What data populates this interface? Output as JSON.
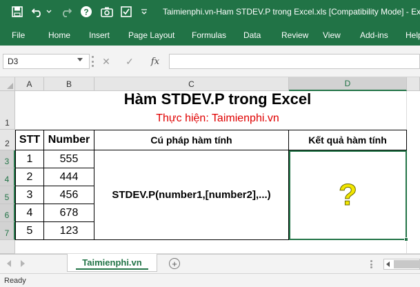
{
  "window": {
    "title": "Taimienphi.vn-Ham STDEV.P trong Excel.xls  [Compatibility Mode]  -  Excel"
  },
  "quick_access": {
    "save_icon": "save-icon",
    "undo_icon": "undo-icon",
    "redo_icon": "redo-icon",
    "help_icon": "help-icon",
    "camera_icon": "camera-icon",
    "checkbox_icon": "checkbox-icon",
    "customize_icon": "chevron-down-icon"
  },
  "ribbon": {
    "tabs": [
      "File",
      "Home",
      "Insert",
      "Page Layout",
      "Formulas",
      "Data",
      "Review",
      "View",
      "Add-ins",
      "Help"
    ]
  },
  "formula_bar": {
    "name_box": "D3",
    "cancel_glyph": "✕",
    "enter_glyph": "✓",
    "fx_label": "fx",
    "formula": ""
  },
  "grid": {
    "columns": [
      "A",
      "B",
      "C",
      "D"
    ],
    "rows": [
      "1",
      "2",
      "3",
      "4",
      "5",
      "6",
      "7"
    ],
    "selected_column": "D",
    "selected_rows": [
      "3",
      "4",
      "5",
      "6",
      "7"
    ]
  },
  "sheet": {
    "title": "Hàm STDEV.P trong Excel",
    "subtitle": "Thực hiện: Taimienphi.vn",
    "headers": {
      "stt": "STT",
      "number": "Number",
      "syntax": "Cú pháp hàm tính",
      "result": "Kết quả hàm tính"
    },
    "rows": [
      {
        "stt": "1",
        "number": "555"
      },
      {
        "stt": "2",
        "number": "444"
      },
      {
        "stt": "3",
        "number": "456"
      },
      {
        "stt": "4",
        "number": "678"
      },
      {
        "stt": "5",
        "number": "123"
      }
    ],
    "syntax_text": "STDEV.P(number1,[number2],...)",
    "result_text": "?"
  },
  "sheet_tabs": {
    "active": "Taimienphi.vn",
    "add_glyph": "+"
  },
  "status": {
    "text": "Ready"
  },
  "colors": {
    "excel_green": "#217346",
    "subtitle_red": "#e00000",
    "question_yellow": "#f2e600"
  }
}
